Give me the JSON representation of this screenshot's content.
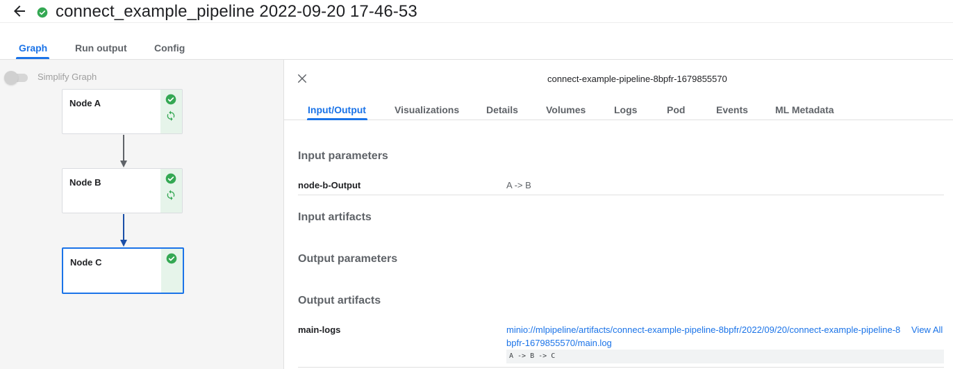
{
  "header": {
    "title": "connect_example_pipeline 2022-09-20 17-46-53",
    "back_icon": "arrow-left-icon",
    "status_icon": "check-circle-icon",
    "status_color": "#34a853"
  },
  "main_tabs": [
    {
      "label": "Graph",
      "active": true
    },
    {
      "label": "Run output",
      "active": false
    },
    {
      "label": "Config",
      "active": false
    }
  ],
  "graph": {
    "simplify_label": "Simplify Graph",
    "simplify_enabled": false,
    "nodes": [
      {
        "label": "Node A",
        "status": "succeeded",
        "cached": true,
        "selected": false
      },
      {
        "label": "Node B",
        "status": "succeeded",
        "cached": true,
        "selected": false
      },
      {
        "label": "Node C",
        "status": "succeeded",
        "cached": false,
        "selected": true
      }
    ]
  },
  "details": {
    "run_id": "connect-example-pipeline-8bpfr-1679855570",
    "tabs": [
      {
        "label": "Input/Output",
        "active": true
      },
      {
        "label": "Visualizations",
        "active": false
      },
      {
        "label": "Details",
        "active": false
      },
      {
        "label": "Volumes",
        "active": false
      },
      {
        "label": "Logs",
        "active": false
      },
      {
        "label": "Pod",
        "active": false
      },
      {
        "label": "Events",
        "active": false
      },
      {
        "label": "ML Metadata",
        "active": false
      }
    ],
    "sections": {
      "input_parameters": "Input parameters",
      "input_artifacts": "Input artifacts",
      "output_parameters": "Output parameters",
      "output_artifacts": "Output artifacts"
    },
    "input_param": {
      "key": "node-b-Output",
      "value": "A -> B"
    },
    "output_artifact": {
      "key": "main-logs",
      "link": "minio://mlpipeline/artifacts/connect-example-pipeline-8bpfr/2022/09/20/connect-example-pipeline-8bpfr-1679855570/main.log",
      "view_all": "View All",
      "preview": "A -> B -> C"
    }
  },
  "colors": {
    "accent": "#1a73e8",
    "success": "#34a853",
    "success_bg": "#e6f4ea"
  }
}
